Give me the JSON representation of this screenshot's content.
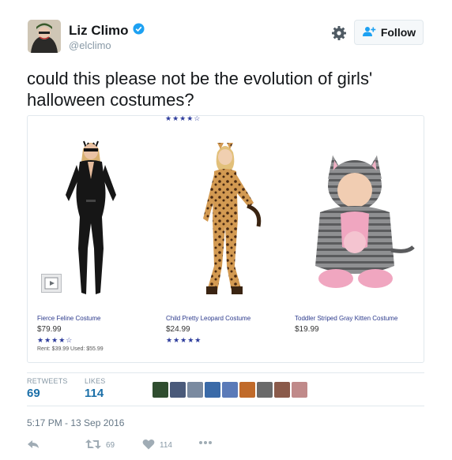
{
  "user": {
    "name": "Liz Climo",
    "handle": "@elclimo",
    "verified": true
  },
  "follow_label": "Follow",
  "tweet_text": "could this please not be the evolution of girls' halloween costumes?",
  "card": {
    "top_rating_stars": "★★★★☆",
    "products": [
      {
        "name": "Fierce Feline Costume",
        "price": "$79.99",
        "stars": "★★★★☆",
        "rent": "Rent: $39.99 Used: $55.99"
      },
      {
        "name": "Child Pretty Leopard Costume",
        "price": "$24.99",
        "stars": "★★★★★"
      },
      {
        "name": "Toddler Striped Gray Kitten Costume",
        "price": "$19.99"
      }
    ]
  },
  "stats": {
    "retweets_label": "RETWEETS",
    "retweets_value": "69",
    "likes_label": "LIKES",
    "likes_value": "114",
    "avatar_colors": [
      "#2f4d2f",
      "#4a5a7a",
      "#7a8aa0",
      "#3a6aa8",
      "#5a7ab8",
      "#c06a2a",
      "#6a6a6a",
      "#8a5a4a",
      "#c08a8a"
    ]
  },
  "timestamp": "5:17 PM - 13 Sep 2016",
  "actions": {
    "retweet_count": "69",
    "like_count": "114"
  },
  "colors": {
    "accent": "#1da1f2",
    "stat_blue": "#1b6fa8"
  }
}
